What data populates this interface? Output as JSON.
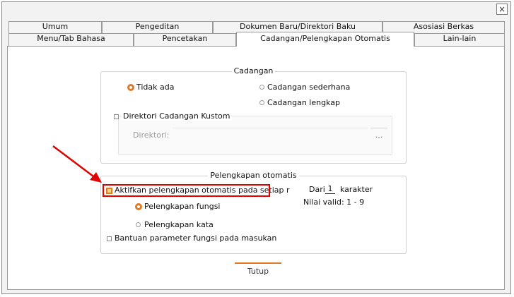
{
  "window": {
    "close_glyph": "×"
  },
  "tabs_row1": [
    {
      "label": "Umum"
    },
    {
      "label": "Pengeditan"
    },
    {
      "label": "Dokumen Baru/Direktori Baku"
    },
    {
      "label": "Asosiasi Berkas"
    }
  ],
  "tabs_row2": [
    {
      "label": "Menu/Tab Bahasa"
    },
    {
      "label": "Pencetakan"
    },
    {
      "label": "Cadangan/Pelengkapan Otomatis",
      "active": true
    },
    {
      "label": "Lain-lain"
    }
  ],
  "backup": {
    "title": "Cadangan",
    "options": [
      {
        "label": "Tidak ada",
        "checked": true
      },
      {
        "label": "Cadangan sederhana",
        "checked": false
      },
      {
        "label": "Cadangan lengkap",
        "checked": false
      }
    ],
    "custom_dir_label": "Direktori Cadangan Kustom",
    "custom_dir_checked": false,
    "dir_label": "Direktori:",
    "dir_value": "",
    "browse_label": "..."
  },
  "autocomplete": {
    "title": "Pelengkapan otomatis",
    "enable_label": "Aktifkan pelengkapan otomatis pada setiap r",
    "enable_checked": true,
    "from_label": "Dari",
    "from_value": "1",
    "chars_label": "karakter",
    "valid_label": "Nilai valid: 1 - 9",
    "options": [
      {
        "label": "Pelengkapan fungsi",
        "checked": true
      },
      {
        "label": "Pelengkapan kata",
        "checked": false
      }
    ],
    "param_help_label": "Bantuan parameter fungsi pada masukan",
    "param_help_checked": false
  },
  "footer": {
    "close_label": "Tutup"
  },
  "colors": {
    "accent": "#e07a26",
    "annotation": "#e00000"
  }
}
